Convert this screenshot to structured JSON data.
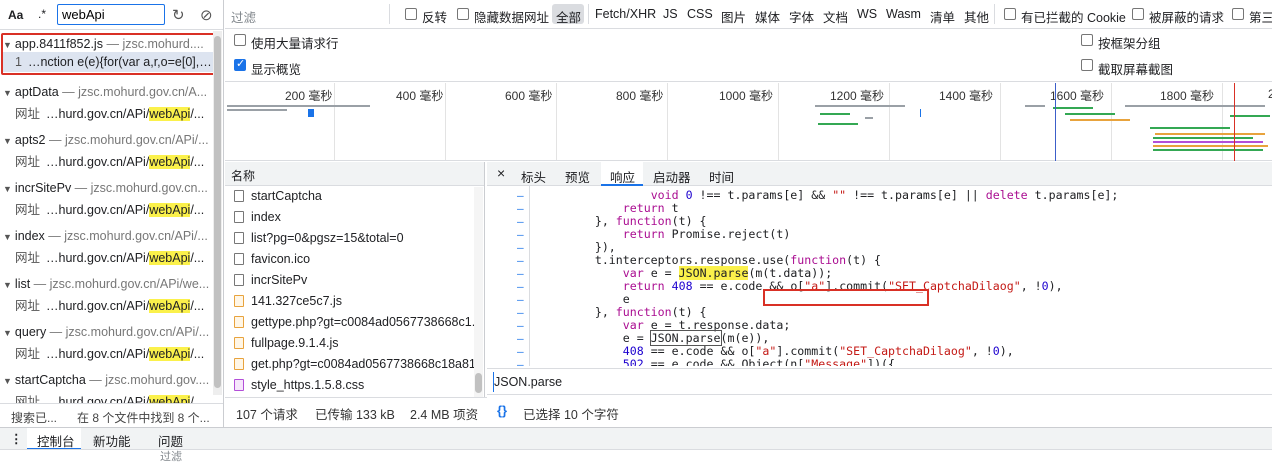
{
  "search": {
    "case_label": "Aa",
    "regex_label": ".*",
    "value": "webApi"
  },
  "results": [
    {
      "file": "app.8411f852.js",
      "domain": "jzsc.mohurd....",
      "line_no": "1",
      "snippet": "…nction e(e){for(var a,r,o=e[0],…"
    },
    {
      "file": "aptData",
      "domain": "jzsc.mohurd.gov.cn/A...",
      "label": "网址",
      "pre": "…hurd.gov.cn/APi/",
      "match": "webApi",
      "post": "/..."
    },
    {
      "file": "apts2",
      "domain": "jzsc.mohurd.gov.cn/APi/...",
      "label": "网址",
      "pre": "…hurd.gov.cn/APi/",
      "match": "webApi",
      "post": "/..."
    },
    {
      "file": "incrSitePv",
      "domain": "jzsc.mohurd.gov.cn...",
      "label": "网址",
      "pre": "…hurd.gov.cn/APi/",
      "match": "webApi",
      "post": "/..."
    },
    {
      "file": "index",
      "domain": "jzsc.mohurd.gov.cn/APi/...",
      "label": "网址",
      "pre": "…hurd.gov.cn/APi/",
      "match": "webApi",
      "post": "/..."
    },
    {
      "file": "list",
      "domain": "jzsc.mohurd.gov.cn/APi/we...",
      "label": "网址",
      "pre": "…hurd.gov.cn/APi/",
      "match": "webApi",
      "post": "/..."
    },
    {
      "file": "query",
      "domain": "jzsc.mohurd.gov.cn/APi/...",
      "label": "网址",
      "pre": "…hurd.gov.cn/APi/",
      "match": "webApi",
      "post": "/..."
    },
    {
      "file": "startCaptcha",
      "domain": "jzsc.mohurd.gov....",
      "label": "网址",
      "pre": "…hurd.gov.cn/APi/",
      "match": "webApi",
      "post": "/..."
    }
  ],
  "left_status": {
    "searching": "搜索已...",
    "found": "在 8 个文件中找到 8 个..."
  },
  "filter": {
    "placeholder": "过滤",
    "invert": "反转",
    "hide_data": "隐藏数据网址",
    "all": "全部",
    "types": [
      "Fetch/XHR",
      "JS",
      "CSS",
      "图片",
      "媒体",
      "字体",
      "文档",
      "WS",
      "Wasm",
      "清单",
      "其他"
    ],
    "blocked_cookies": "有已拦截的 Cookie",
    "blocked_requests": "被屏蔽的请求",
    "third_party": "第三"
  },
  "options": {
    "large_rows": "使用大量请求行",
    "overview": "显示概览",
    "group_by_frame": "按框架分组",
    "screenshots": "截取屏幕截图",
    "overview_checked": true
  },
  "timeline": {
    "ticks": [
      "200 毫秒",
      "400 毫秒",
      "600 毫秒",
      "800 毫秒",
      "1000 毫秒",
      "1200 毫秒",
      "1400 毫秒",
      "1600 毫秒",
      "1800 毫秒",
      "2"
    ]
  },
  "name_column": {
    "header": "名称",
    "requests": [
      {
        "name": "startCaptcha",
        "type": "doc"
      },
      {
        "name": "index",
        "type": "doc"
      },
      {
        "name": "list?pg=0&pgsz=15&total=0",
        "type": "doc"
      },
      {
        "name": "favicon.ico",
        "type": "doc"
      },
      {
        "name": "incrSitePv",
        "type": "doc"
      },
      {
        "name": "141.327ce5c7.js",
        "type": "js"
      },
      {
        "name": "gettype.php?gt=c0084ad0567738668c1...",
        "type": "js"
      },
      {
        "name": "fullpage.9.1.4.js",
        "type": "js"
      },
      {
        "name": "get.php?gt=c0084ad0567738668c18a81...",
        "type": "js"
      },
      {
        "name": "style_https.1.5.8.css",
        "type": "css"
      }
    ]
  },
  "net_status": {
    "requests": "107 个请求",
    "transferred": "已传输 133 kB",
    "resources": "2.4 MB 项资"
  },
  "detail_tabs": {
    "close": "×",
    "headers": "标头",
    "preview": "预览",
    "response": "响应",
    "initiator": "启动器",
    "timing": "时间"
  },
  "code_lines": [
    "                void 0 !== t.params[e] && \"\" !== t.params[e] || delete t.params[e];",
    "            return t",
    "        }, function(t) {",
    "            return Promise.reject(t)",
    "        }),",
    "        t.interceptors.response.use(function(t) {",
    "            var e = JSON.parse(m(t.data));",
    "            return 408 == e.code && o[\"a\"].commit(\"SET_CaptchaDilaog\", !0),",
    "            e",
    "        }, function(t) {",
    "            var e = t.response.data;",
    "            e = JSON.parse(m(e)),",
    "            408 == e.code && o[\"a\"].commit(\"SET_CaptchaDilaog\", !0),",
    "            502 == e.code && Object(n[\"Message\"])({"
  ],
  "find": {
    "value": "JSON.parse"
  },
  "detail_status": {
    "brace": "{}",
    "selected": "已选择 10 个字符"
  },
  "drawer": {
    "console": "控制台",
    "whats_new": "新功能",
    "issues": "问题"
  },
  "console_bar": {
    "filter": "过滤"
  },
  "colors": {
    "accent": "#1a73e8",
    "highlight": "#fbf14b",
    "annotation": "#d93025"
  }
}
